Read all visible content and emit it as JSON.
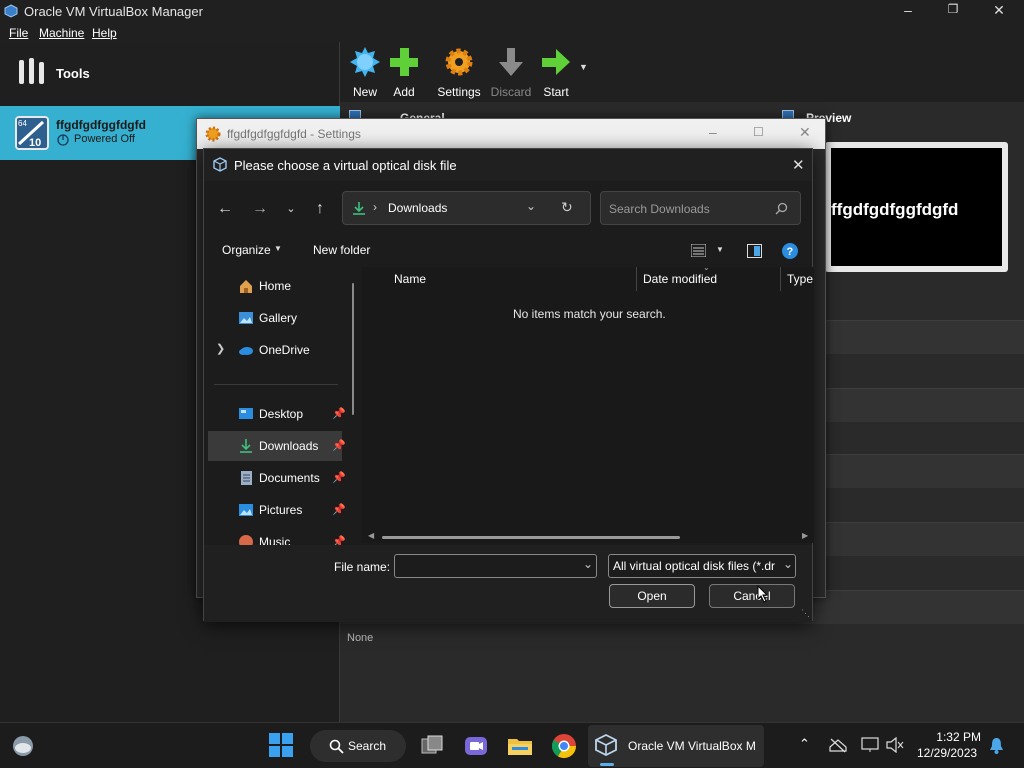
{
  "window": {
    "title": "Oracle VM VirtualBox Manager"
  },
  "menu": [
    {
      "label": "File"
    },
    {
      "label": "Machine"
    },
    {
      "label": "Help"
    }
  ],
  "left": {
    "tools_label": "Tools",
    "vm": {
      "name": "ffgdfgdfggfdgfd",
      "status": "Powered Off"
    }
  },
  "toolbar": {
    "new": "New",
    "add": "Add",
    "settings": "Settings",
    "discard": "Discard",
    "start": "Start"
  },
  "right": {
    "general": "General",
    "preview": "Preview",
    "preview_name": "ffgdfgdfggfdgfd",
    "none": "None"
  },
  "settings_dialog": {
    "title": "ffgdfgdfggfdgfd - Settings"
  },
  "file_dialog": {
    "title": "Please choose a virtual optical disk file",
    "address": "Downloads",
    "search_placeholder": "Search Downloads",
    "organize": "Organize",
    "new_folder": "New folder",
    "nav": {
      "home": "Home",
      "gallery": "Gallery",
      "onedrive": "OneDrive",
      "desktop": "Desktop",
      "downloads": "Downloads",
      "documents": "Documents",
      "pictures": "Pictures",
      "music": "Music"
    },
    "columns": {
      "name": "Name",
      "date": "Date modified",
      "type": "Type"
    },
    "empty_message": "No items match your search.",
    "file_name_label": "File name:",
    "file_name_value": "",
    "filter": "All virtual optical disk files (*.dr",
    "open": "Open",
    "cancel": "Cancel"
  },
  "taskbar": {
    "search": "Search",
    "active_app": "Oracle VM VirtualBox M",
    "time": "1:32 PM",
    "date": "12/29/2023"
  },
  "colors": {
    "accent": "#35b0d0",
    "selection": "#3a3a3a",
    "download_green": "#3fbf7f"
  }
}
